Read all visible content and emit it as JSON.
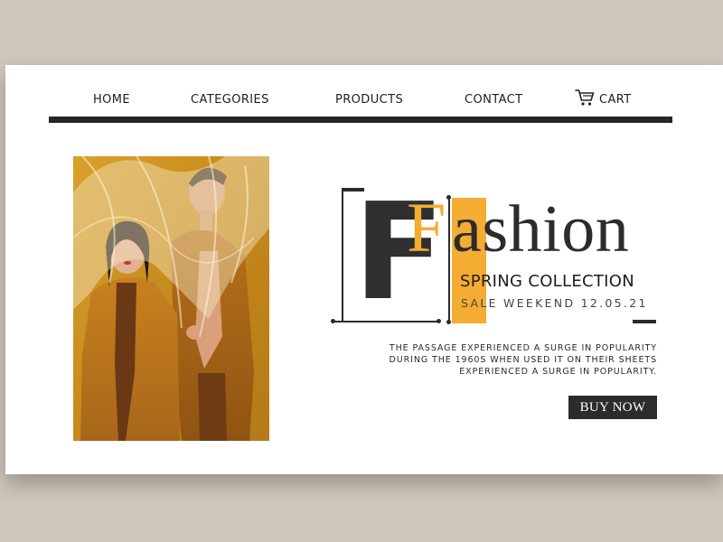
{
  "nav": {
    "items": [
      {
        "label": "HOME"
      },
      {
        "label": "CATEGORIES"
      },
      {
        "label": "PRODUCTS"
      },
      {
        "label": "CONTACT"
      }
    ],
    "cart_label": "CART",
    "cart_icon": "cart-icon"
  },
  "hero": {
    "initial": "F",
    "accent_initial": "F",
    "word": "ashion",
    "subtitle": "SPRING COLLECTION",
    "sale_line": "SALE WEEKEND 12.05.21",
    "description": [
      "THE PASSAGE EXPERIENCED A SURGE IN POPULARITY",
      "DURING THE 1960S WHEN USED IT ON THEIR SHEETS",
      "EXPERIENCED A SURGE IN POPULARITY."
    ],
    "button_label": "BUY NOW"
  },
  "colors": {
    "background": "#cfc7bd",
    "card": "#ffffff",
    "accent": "#f5ac32",
    "dark": "#2c2c2c"
  }
}
